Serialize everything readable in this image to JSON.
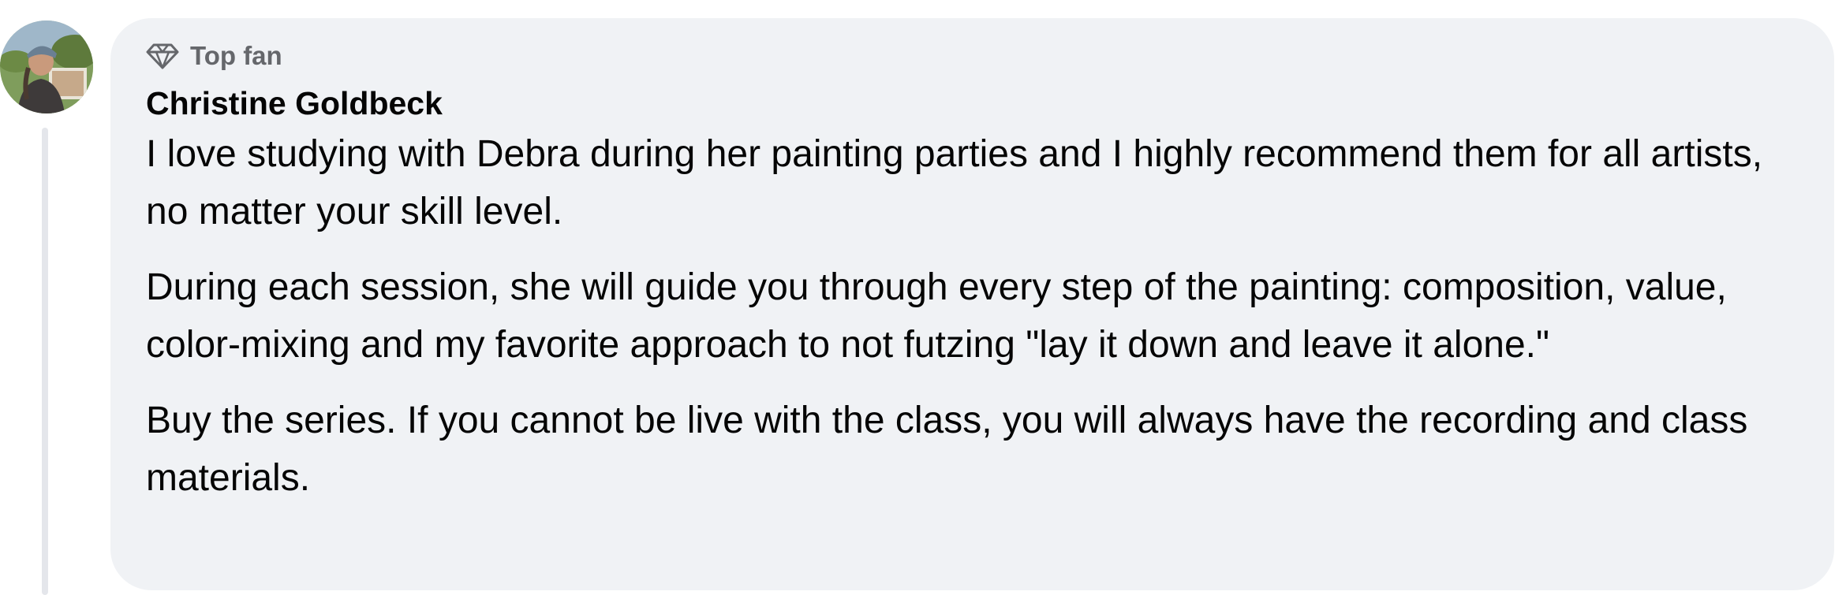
{
  "comment": {
    "badge_label": "Top fan",
    "badge_icon": "diamond-icon",
    "author": "Christine Goldbeck",
    "paragraphs": [
      "I love studying with Debra during her painting parties and I highly recommend them for all artists, no matter your skill level.",
      "During each session, she will guide you through every step of the painting: composition, value, color-mixing and my favorite approach to not futzing \"lay it down and leave it alone.\"",
      "Buy the series. If you cannot be live with the class, you will always have the recording and class materials."
    ]
  },
  "colors": {
    "bubble_bg": "#f0f2f5",
    "text": "#050505",
    "secondary_text": "#65676b",
    "thread_line": "#e4e6eb"
  }
}
